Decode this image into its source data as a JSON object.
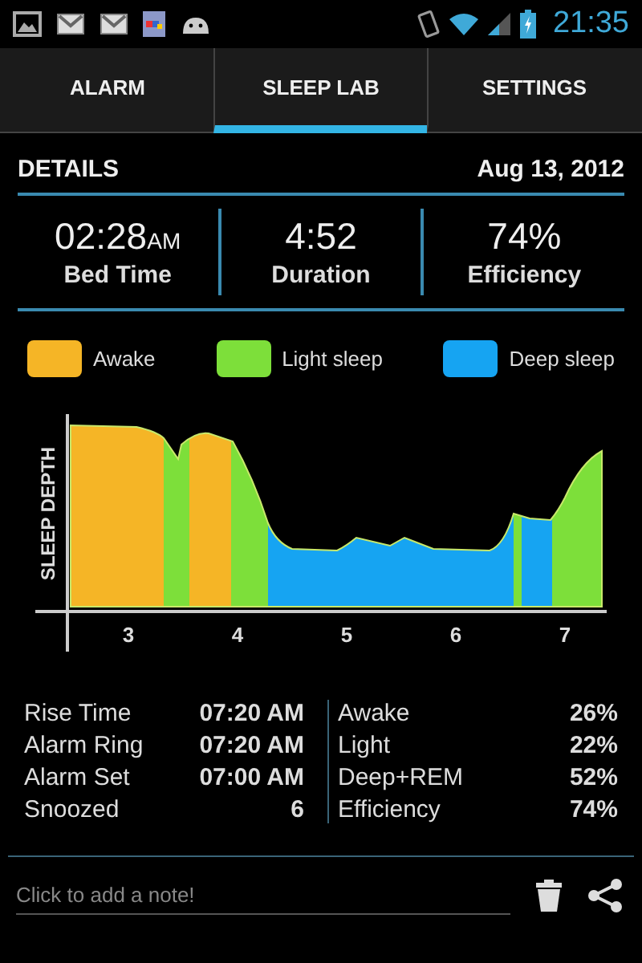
{
  "status_bar": {
    "time": "21:35"
  },
  "tabs": [
    {
      "label": "ALARM",
      "selected": false
    },
    {
      "label": "SLEEP LAB",
      "selected": true
    },
    {
      "label": "SETTINGS",
      "selected": false
    }
  ],
  "details": {
    "title": "DETAILS",
    "date": "Aug 13, 2012"
  },
  "summary": [
    {
      "value": "02:28",
      "suffix": "AM",
      "label": "Bed Time"
    },
    {
      "value": "4:52",
      "label": "Duration"
    },
    {
      "value": "74%",
      "label": "Efficiency"
    }
  ],
  "legend": [
    {
      "label": "Awake",
      "color": "#f5b526"
    },
    {
      "label": "Light sleep",
      "color": "#7ddf3a"
    },
    {
      "label": "Deep sleep",
      "color": "#16a4f2"
    }
  ],
  "chart": {
    "ylabel": "SLEEP DEPTH",
    "xlabels": [
      "3",
      "4",
      "5",
      "6",
      "7"
    ]
  },
  "times": [
    {
      "label": "Rise Time",
      "value": "07:20 AM"
    },
    {
      "label": "Alarm Ring",
      "value": "07:20 AM"
    },
    {
      "label": "Alarm Set",
      "value": "07:00 AM"
    },
    {
      "label": "Snoozed",
      "value": "6"
    }
  ],
  "shares": [
    {
      "label": "Awake",
      "value": "26%"
    },
    {
      "label": "Light",
      "value": "22%"
    },
    {
      "label": "Deep+REM",
      "value": "52%"
    },
    {
      "label": "Efficiency",
      "value": "74%"
    }
  ],
  "note": {
    "placeholder": "Click to add a note!"
  }
}
